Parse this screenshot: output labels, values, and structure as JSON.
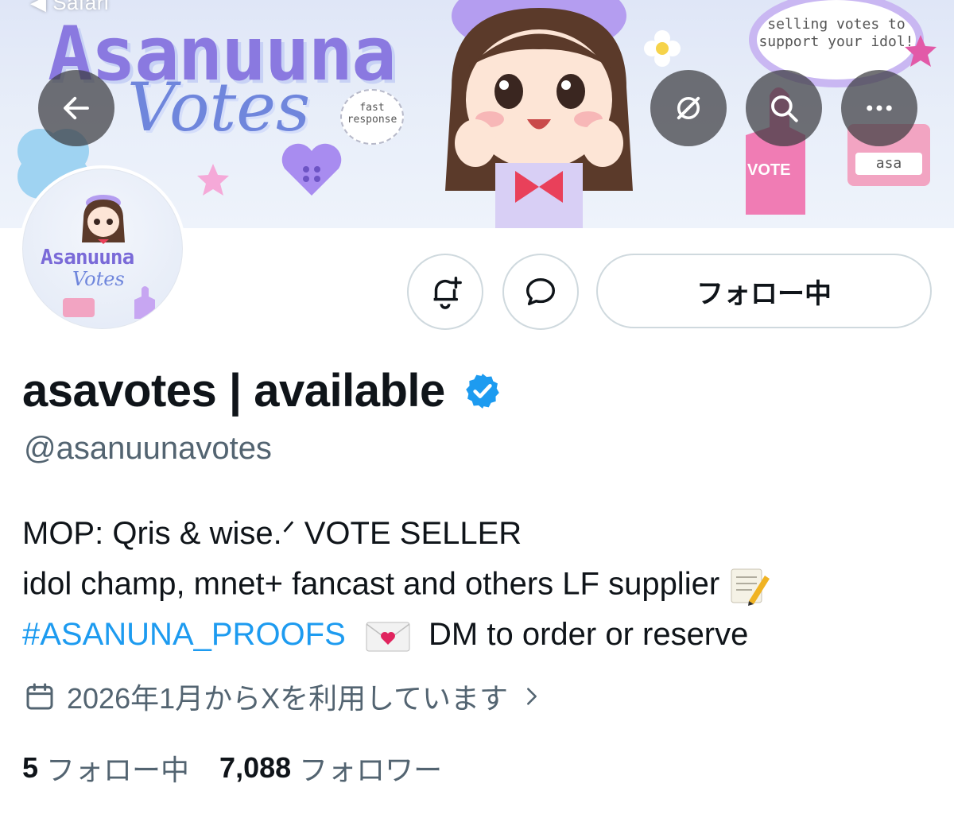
{
  "status_bar": {
    "back_app": "◀ Safari"
  },
  "banner": {
    "title": "Asanuuna",
    "subtitle": "Votes",
    "bubble_fast": "fast response",
    "bubble_sell": "selling votes to support your idol!",
    "vote_sign": "VOTE",
    "name_tag": "asa"
  },
  "avatar": {
    "title": "Asanuuna",
    "subtitle": "Votes"
  },
  "top_icons": [
    "back-arrow-icon",
    "grok-icon",
    "search-icon",
    "more-icon"
  ],
  "actions": {
    "follow_label": "フォロー中"
  },
  "profile": {
    "display_name": "asavotes | available",
    "handle": "@asanuunavotes",
    "bio_line1": "MOP: Qris & wise.ᐟ VOTE SELLER",
    "bio_line2": "idol champ, mnet+ fancast and others LF supplier",
    "bio_hashtag": "#ASANUNA_PROOFS",
    "bio_line3_rest": "DM to order or reserve",
    "joined": "2026年1月からXを利用しています"
  },
  "stats": {
    "following_count": "5",
    "following_label": "フォロー中",
    "followers_count": "7,088",
    "followers_label": "フォロワー"
  },
  "colors": {
    "accent": "#1d9bf0",
    "text": "#0f1419",
    "muted": "#536471",
    "border": "#cfd9de"
  }
}
